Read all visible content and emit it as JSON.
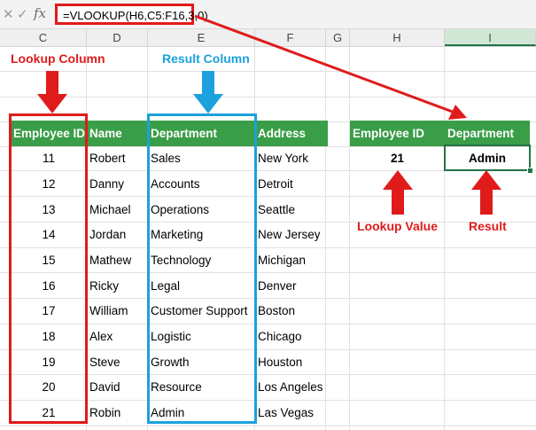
{
  "formula_bar": {
    "cancel_icon": "close-icon",
    "confirm_icon": "checkmark-icon",
    "fx_label": "fx",
    "formula": "=VLOOKUP(H6,C5:F16,3,0)"
  },
  "columns": [
    "C",
    "D",
    "E",
    "F",
    "G",
    "H",
    "I"
  ],
  "selected_column": "I",
  "table": {
    "headers": [
      "Employee ID",
      "Name",
      "Department",
      "Address"
    ],
    "rows": [
      [
        "11",
        "Robert",
        "Sales",
        "New York"
      ],
      [
        "12",
        "Danny",
        "Accounts",
        "Detroit"
      ],
      [
        "13",
        "Michael",
        "Operations",
        "Seattle"
      ],
      [
        "14",
        "Jordan",
        "Marketing",
        "New Jersey"
      ],
      [
        "15",
        "Mathew",
        "Technology",
        "Michigan"
      ],
      [
        "16",
        "Ricky",
        "Legal",
        "Denver"
      ],
      [
        "17",
        "William",
        "Customer Support",
        "Boston"
      ],
      [
        "18",
        "Alex",
        "Logistic",
        "Chicago"
      ],
      [
        "19",
        "Steve",
        "Growth",
        "Houston"
      ],
      [
        "20",
        "David",
        "Resource",
        "Los Angeles"
      ],
      [
        "21",
        "Robin",
        "Admin",
        "Las Vegas"
      ]
    ]
  },
  "lookup": {
    "headers": [
      "Employee ID",
      "Department"
    ],
    "values": [
      "21",
      "Admin"
    ]
  },
  "annotations": {
    "lookup_column": "Lookup Column",
    "result_column": "Result Column",
    "lookup_value": "Lookup Value",
    "result": "Result"
  },
  "colors": {
    "header_green": "#3a9d47",
    "highlight_red": "#e01b1b",
    "highlight_blue": "#1ca1dd"
  }
}
